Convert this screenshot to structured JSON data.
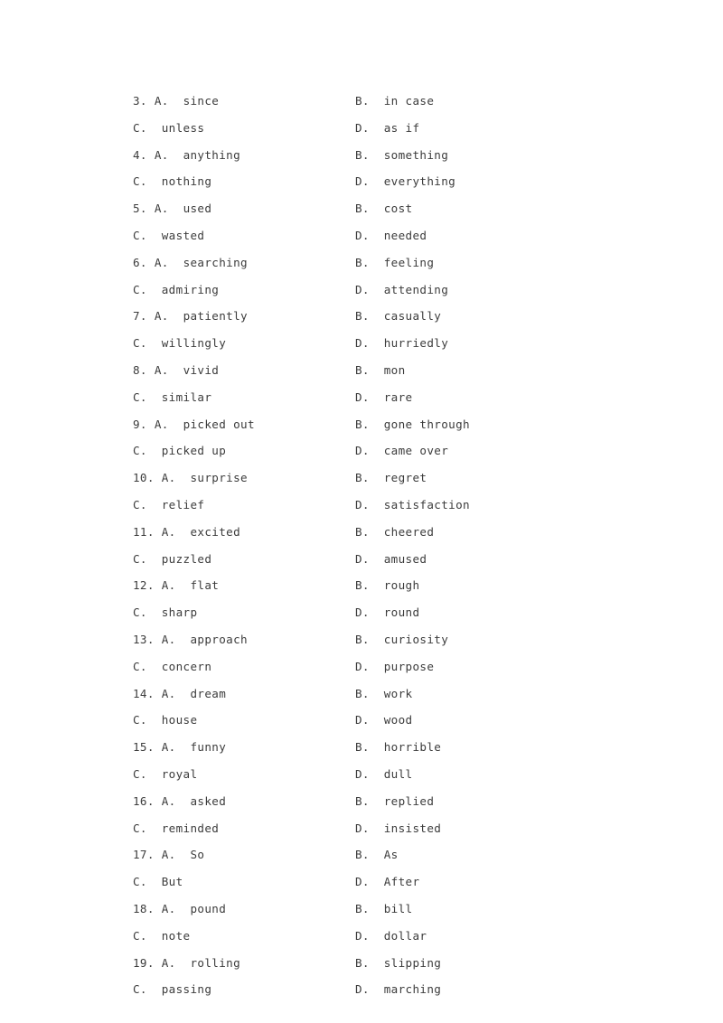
{
  "document": {
    "type": "exam-answer-options-page",
    "page_background": "#ffffff",
    "text_color": "#3c3c3c",
    "rows": [
      {
        "number": "3.",
        "left": {
          "label": "A.",
          "text": "since"
        },
        "right": {
          "label": "B.",
          "text": "in case"
        }
      },
      {
        "number": "",
        "left": {
          "label": "C.",
          "text": "unless"
        },
        "right": {
          "label": "D.",
          "text": "as if"
        }
      },
      {
        "number": "4.",
        "left": {
          "label": "A.",
          "text": "anything"
        },
        "right": {
          "label": "B.",
          "text": "something"
        }
      },
      {
        "number": "",
        "left": {
          "label": "C.",
          "text": "nothing"
        },
        "right": {
          "label": "D.",
          "text": "everything"
        }
      },
      {
        "number": "5.",
        "left": {
          "label": "A.",
          "text": "used"
        },
        "right": {
          "label": "B.",
          "text": "cost"
        }
      },
      {
        "number": "",
        "left": {
          "label": "C.",
          "text": "wasted"
        },
        "right": {
          "label": "D.",
          "text": "needed"
        }
      },
      {
        "number": "6.",
        "left": {
          "label": "A.",
          "text": "searching"
        },
        "right": {
          "label": "B.",
          "text": "feeling"
        }
      },
      {
        "number": "",
        "left": {
          "label": "C.",
          "text": "admiring"
        },
        "right": {
          "label": "D.",
          "text": "attending"
        }
      },
      {
        "number": "7.",
        "left": {
          "label": "A.",
          "text": "patiently"
        },
        "right": {
          "label": "B.",
          "text": "casually"
        }
      },
      {
        "number": "",
        "left": {
          "label": "C.",
          "text": "willingly"
        },
        "right": {
          "label": "D.",
          "text": "hurriedly"
        }
      },
      {
        "number": "8.",
        "left": {
          "label": "A.",
          "text": "vivid"
        },
        "right": {
          "label": "B.",
          "text": "mon"
        }
      },
      {
        "number": "",
        "left": {
          "label": "C.",
          "text": "similar"
        },
        "right": {
          "label": "D.",
          "text": "rare"
        }
      },
      {
        "number": "9.",
        "left": {
          "label": "A.",
          "text": "picked out"
        },
        "right": {
          "label": "B.",
          "text": "gone through"
        }
      },
      {
        "number": "",
        "left": {
          "label": "C.",
          "text": "picked up"
        },
        "right": {
          "label": "D.",
          "text": "came over"
        }
      },
      {
        "number": "10.",
        "left": {
          "label": "A.",
          "text": "surprise"
        },
        "right": {
          "label": "B.",
          "text": "regret"
        }
      },
      {
        "number": "",
        "left": {
          "label": "C.",
          "text": "relief"
        },
        "right": {
          "label": "D.",
          "text": "satisfaction"
        }
      },
      {
        "number": "11.",
        "left": {
          "label": "A.",
          "text": "excited"
        },
        "right": {
          "label": "B.",
          "text": "cheered"
        }
      },
      {
        "number": "",
        "left": {
          "label": "C.",
          "text": "puzzled"
        },
        "right": {
          "label": "D.",
          "text": "amused"
        }
      },
      {
        "number": "12.",
        "left": {
          "label": "A.",
          "text": "flat"
        },
        "right": {
          "label": "B.",
          "text": "rough"
        }
      },
      {
        "number": "",
        "left": {
          "label": "C.",
          "text": "sharp"
        },
        "right": {
          "label": "D.",
          "text": "round"
        }
      },
      {
        "number": "13.",
        "left": {
          "label": "A.",
          "text": "approach"
        },
        "right": {
          "label": "B.",
          "text": "curiosity"
        }
      },
      {
        "number": "",
        "left": {
          "label": "C.",
          "text": "concern"
        },
        "right": {
          "label": "D.",
          "text": "purpose"
        }
      },
      {
        "number": "14.",
        "left": {
          "label": "A.",
          "text": "dream"
        },
        "right": {
          "label": "B.",
          "text": "work"
        }
      },
      {
        "number": "",
        "left": {
          "label": "C.",
          "text": "house"
        },
        "right": {
          "label": "D.",
          "text": "wood"
        }
      },
      {
        "number": "15.",
        "left": {
          "label": "A.",
          "text": "funny"
        },
        "right": {
          "label": "B.",
          "text": "horrible"
        }
      },
      {
        "number": "",
        "left": {
          "label": "C.",
          "text": "royal"
        },
        "right": {
          "label": "D.",
          "text": "dull"
        }
      },
      {
        "number": "16.",
        "left": {
          "label": "A.",
          "text": "asked"
        },
        "right": {
          "label": "B.",
          "text": "replied"
        }
      },
      {
        "number": "",
        "left": {
          "label": "C.",
          "text": "reminded"
        },
        "right": {
          "label": "D.",
          "text": "insisted"
        }
      },
      {
        "number": "17.",
        "left": {
          "label": "A.",
          "text": "So"
        },
        "right": {
          "label": "B.",
          "text": "As"
        }
      },
      {
        "number": "",
        "left": {
          "label": "C.",
          "text": "But"
        },
        "right": {
          "label": "D.",
          "text": "After"
        }
      },
      {
        "number": "18.",
        "left": {
          "label": "A.",
          "text": "pound"
        },
        "right": {
          "label": "B.",
          "text": "bill"
        }
      },
      {
        "number": "",
        "left": {
          "label": "C.",
          "text": "note"
        },
        "right": {
          "label": "D.",
          "text": "dollar"
        }
      },
      {
        "number": "19.",
        "left": {
          "label": "A.",
          "text": "rolling"
        },
        "right": {
          "label": "B.",
          "text": "slipping"
        }
      },
      {
        "number": "",
        "left": {
          "label": "C.",
          "text": "passing"
        },
        "right": {
          "label": "D.",
          "text": "marching"
        }
      }
    ]
  }
}
